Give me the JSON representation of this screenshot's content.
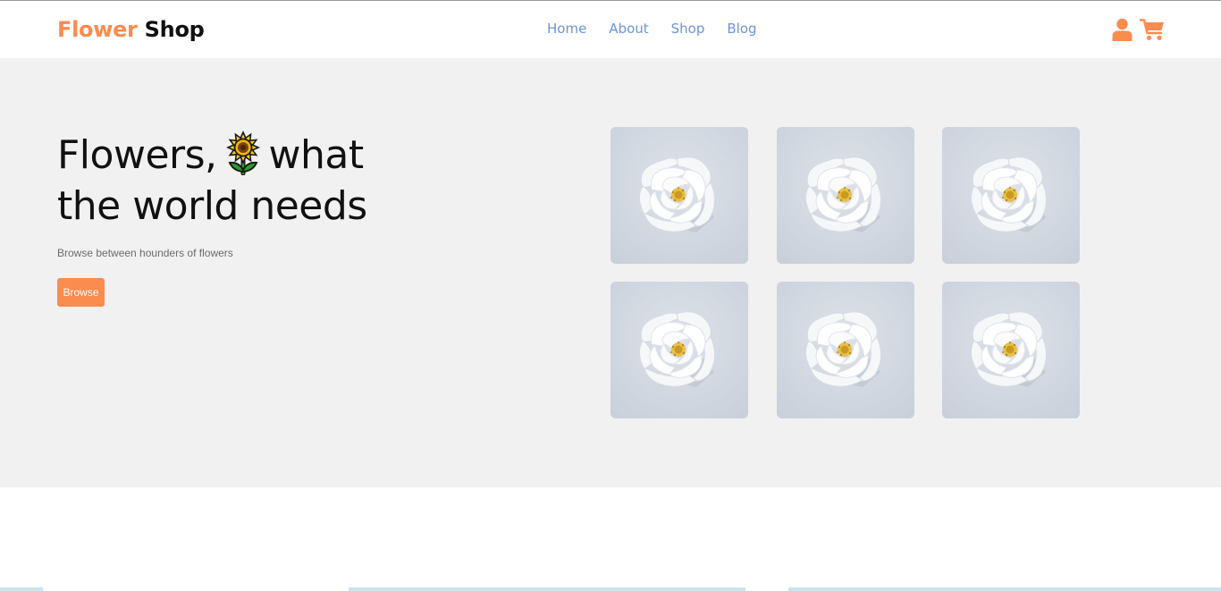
{
  "brand": {
    "part1": "Flower",
    "part2": "Shop"
  },
  "nav": {
    "items": [
      "Home",
      "About",
      "Shop",
      "Blog"
    ]
  },
  "header_icons": [
    "user-icon",
    "cart-icon"
  ],
  "hero": {
    "title_line1_before": "Flowers,",
    "title_emoji": "sunflower",
    "title_line1_after": "what",
    "title_line2": "the world needs",
    "subtitle": "Browse between hounders of flowers",
    "button_label": "Browse"
  },
  "products": {
    "count": 6,
    "image": "white-rose"
  },
  "colors": {
    "accent": "#fb8c4f",
    "nav_link": "#6c95d8",
    "hero_bg": "#f1f1f1",
    "card_bg": "#d0d6df",
    "text": "#111111"
  }
}
